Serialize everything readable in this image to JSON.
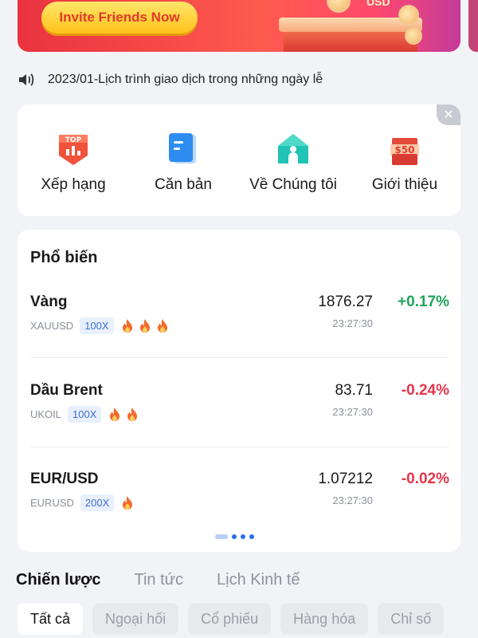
{
  "banner": {
    "invite_label": "Invite Friends Now",
    "currency": "USD",
    "accent": "#e8333f"
  },
  "notice": {
    "icon": "speaker-icon",
    "text": "2023/01-Lịch trình giao dịch trong những ngày lễ"
  },
  "shortcuts": [
    {
      "label": "Xếp hạng",
      "icon": "top-ranking-icon"
    },
    {
      "label": "Căn bản",
      "icon": "document-icon"
    },
    {
      "label": "Về Chúng tôi",
      "icon": "home-icon"
    },
    {
      "label": "Giới thiệu",
      "icon": "gift-50-icon",
      "badge": "$50"
    }
  ],
  "popular": {
    "title": "Phổ biến",
    "rows": [
      {
        "name": "Vàng",
        "symbol": "XAUUSD",
        "leverage": "100X",
        "fires": 3,
        "price": "1876.27",
        "time": "23:27:30",
        "change": "+0.17%",
        "direction": "up"
      },
      {
        "name": "Dầu Brent",
        "symbol": "UKOIL",
        "leverage": "100X",
        "fires": 2,
        "price": "83.71",
        "time": "23:27:30",
        "change": "-0.24%",
        "direction": "down"
      },
      {
        "name": "EUR/USD",
        "symbol": "EURUSD",
        "leverage": "200X",
        "fires": 1,
        "price": "1.07212",
        "time": "23:27:30",
        "change": "-0.02%",
        "direction": "down"
      }
    ],
    "pager": {
      "pages": 4,
      "active": 0
    }
  },
  "tabs": [
    {
      "label": "Chiến lược",
      "active": true
    },
    {
      "label": "Tin tức",
      "active": false
    },
    {
      "label": "Lịch Kinh tế",
      "active": false
    }
  ],
  "filters": [
    {
      "label": "Tất cả",
      "active": true
    },
    {
      "label": "Ngoại hối",
      "active": false
    },
    {
      "label": "Cổ phiếu",
      "active": false
    },
    {
      "label": "Hàng hóa",
      "active": false
    },
    {
      "label": "Chỉ số",
      "active": false
    }
  ],
  "colors": {
    "up": "#1ea459",
    "down": "#e5364b",
    "link": "#3b6fd4"
  }
}
